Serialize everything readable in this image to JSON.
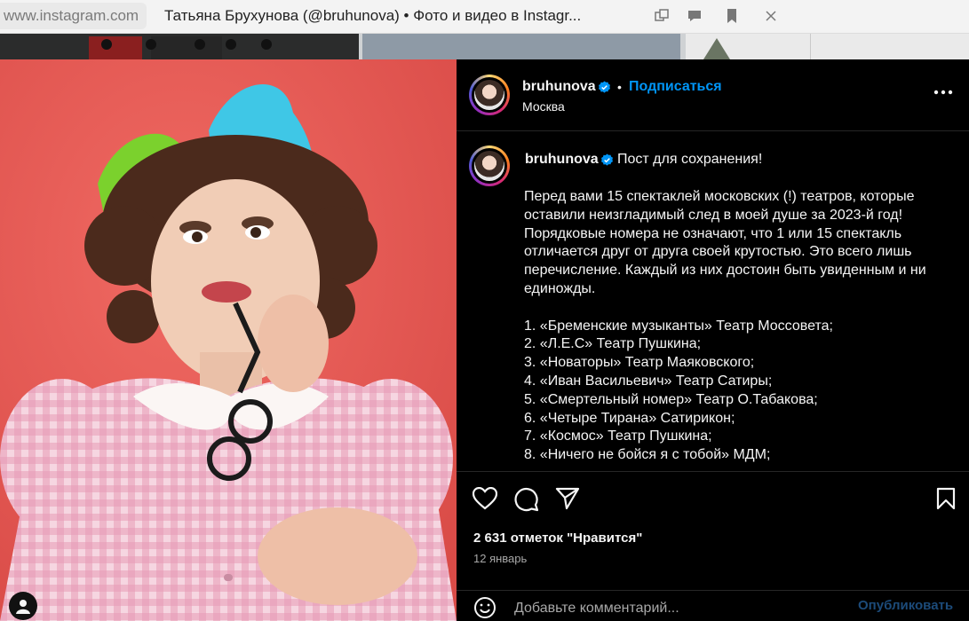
{
  "browser": {
    "url": "www.instagram.com",
    "tab_title": "Татьяна Брухунова (@bruhunova) • Фото и видео в Instagr..."
  },
  "post": {
    "username": "bruhunova",
    "separator": "•",
    "follow_label": "Подписаться",
    "location": "Москва",
    "caption": {
      "username": "bruhunova",
      "title": "Пост для сохранения!",
      "intro": "Перед вами 15 спектаклей московских (!) театров, которые оставили неизгладимый след в моей душе за 2023-й год! Порядковые номера не означают, что 1 или 15 спектакль отличается друг от друга своей крутостью. Это всего лишь перечисление. Каждый из них достоин быть увиденным и ни единожды.",
      "list": [
        "1. «Бременские музыканты» Театр Моссовета;",
        "2. «Л.Е.С» Театр Пушкина;",
        "3. «Новаторы» Театр Маяковского;",
        "4. «Иван Васильевич» Театр Сатиры;",
        "5. «Смертельный номер» Театр О.Табакова;",
        "6. «Четыре Тирана» Сатирикон;",
        "7. «Космос» Театр Пушкина;",
        "8. «Ничего не бойся я с тобой» МДМ;"
      ]
    },
    "likes": "2 631 отметок \"Нравится\"",
    "date": "12 январь",
    "comment_placeholder": "Добавьте комментарий...",
    "publish_label": "Опубликовать"
  },
  "colors": {
    "accent": "#0095f6",
    "photo_bg": "#e85a55",
    "panel_bg": "#000000"
  },
  "icons": {
    "verified": "verified-badge-icon",
    "more": "more-options-icon",
    "like": "heart-icon",
    "comment": "comment-icon",
    "share": "share-icon",
    "save": "bookmark-icon",
    "emoji": "emoji-icon"
  }
}
